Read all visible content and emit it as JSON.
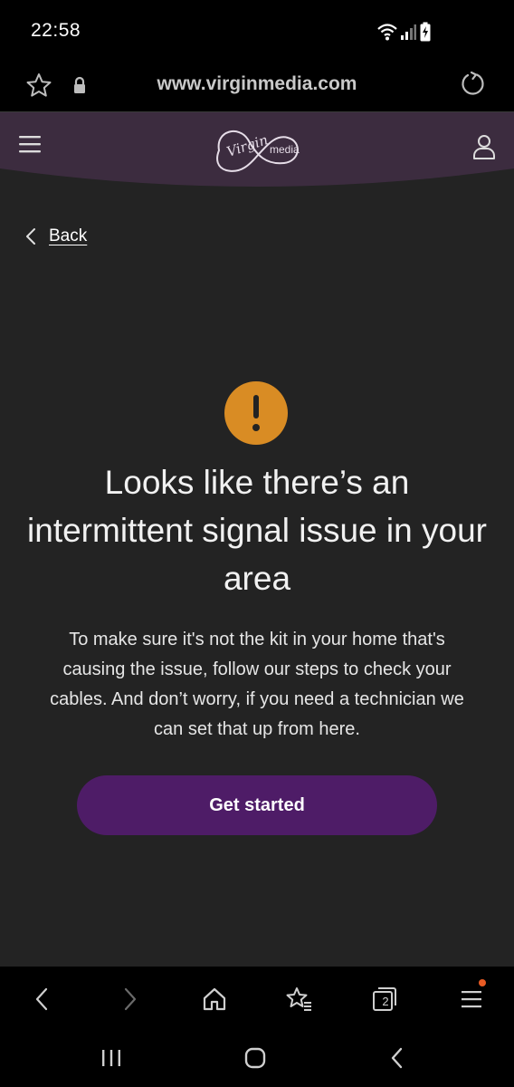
{
  "status_bar": {
    "time": "22:58"
  },
  "browser": {
    "url": "www.virginmedia.com",
    "tabs_count": "2"
  },
  "header": {
    "logo_virgin": "Virgin",
    "logo_media": "media"
  },
  "back": {
    "label": "Back"
  },
  "main": {
    "headline": "Looks like there’s an intermittent signal issue in your area",
    "body": "To make sure it's not the kit in your home that's causing the issue, follow our steps to check your cables. And don’t worry, if you need a technician we can set that up from here.",
    "cta_label": "Get started"
  },
  "colors": {
    "background": "#232323",
    "header": "#3c2c3f",
    "alert": "#d98c24",
    "cta": "#4e1c67",
    "notification_dot": "#e95b24"
  }
}
